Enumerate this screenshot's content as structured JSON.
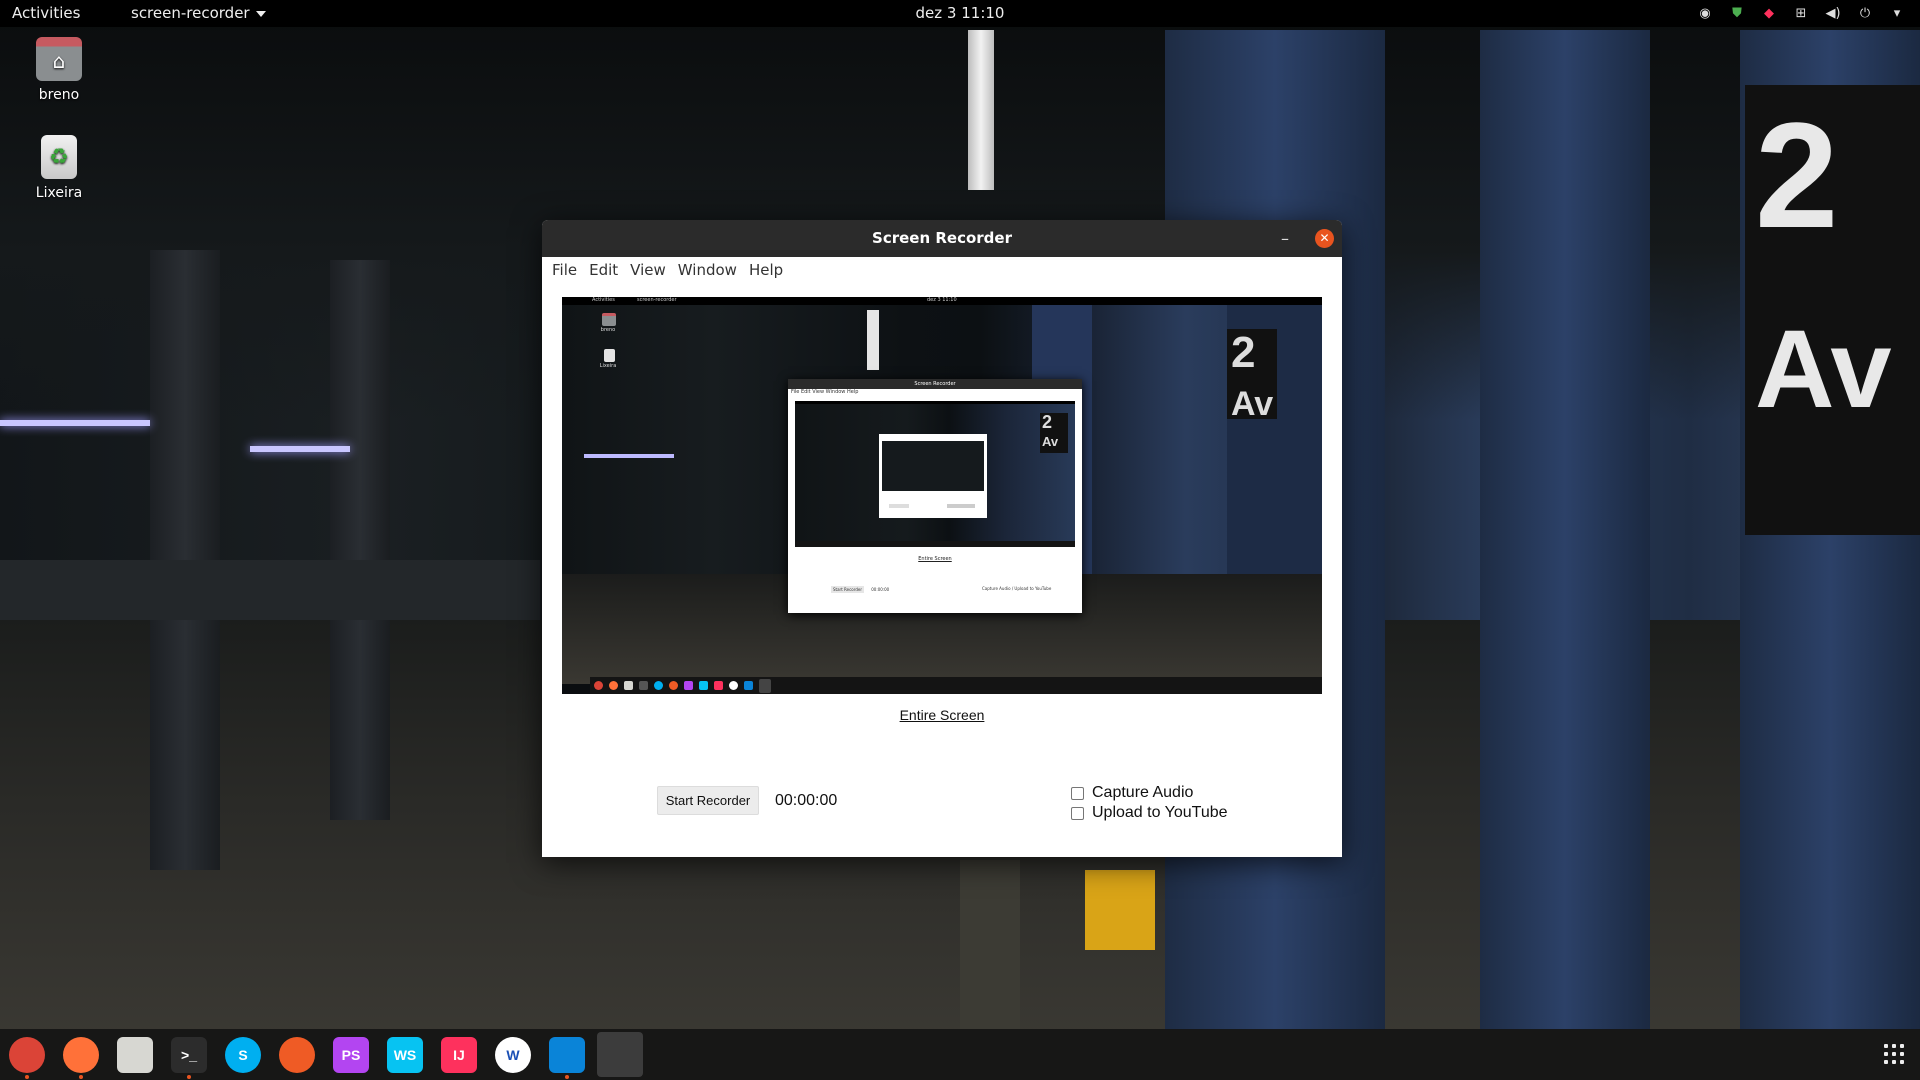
{
  "topbar": {
    "activities": "Activities",
    "app_menu": "screen-recorder",
    "clock": "dez 3  11:10",
    "tray_icons": [
      "discord-icon",
      "shield-icon",
      "jetbrains-toolbox-icon",
      "network-icon",
      "volume-icon",
      "power-icon",
      "chevron-down-icon"
    ]
  },
  "desktop": {
    "icons": [
      {
        "label": "breno",
        "icon": "home-folder-icon"
      },
      {
        "label": "Lixeira",
        "icon": "trash-icon"
      }
    ]
  },
  "window": {
    "title": "Screen Recorder",
    "menu": [
      "File",
      "Edit",
      "View",
      "Window",
      "Help"
    ],
    "preview_caption": "Entire Screen",
    "start_button": "Start Recorder",
    "timer": "00:00:00",
    "options": [
      {
        "label": "Capture Audio",
        "checked": false
      },
      {
        "label": "Upload to YouTube",
        "checked": false
      }
    ]
  },
  "preview": {
    "activities": "Activities",
    "app_menu": "screen-recorder",
    "clock": "dez 3  11:10",
    "desk_labels": [
      "breno",
      "Lixeira"
    ],
    "window_title": "Screen Recorder",
    "menu": "File  Edit  View  Window  Help",
    "caption": "Entire Screen",
    "start": "Start Recorder",
    "timer": "00:00:00",
    "options": "Capture Audio / Upload to YouTube"
  },
  "dock": {
    "apps": [
      {
        "name": "chrome-icon",
        "label": "",
        "color": "#db4437",
        "running": true
      },
      {
        "name": "firefox-icon",
        "label": "",
        "color": "#ff7139",
        "running": true
      },
      {
        "name": "files-icon",
        "label": "",
        "color": "#d7d7d2",
        "running": false
      },
      {
        "name": "terminal-icon",
        "label": ">_",
        "color": "#2c2c2c",
        "running": true
      },
      {
        "name": "skype-icon",
        "label": "S",
        "color": "#00aff0",
        "running": false
      },
      {
        "name": "postman-icon",
        "label": "",
        "color": "#ef5b25",
        "running": false
      },
      {
        "name": "phpstorm-icon",
        "label": "PS",
        "color": "#b345f1",
        "running": false
      },
      {
        "name": "webstorm-icon",
        "label": "WS",
        "color": "#07c3f2",
        "running": false
      },
      {
        "name": "intellij-icon",
        "label": "IJ",
        "color": "#fe315d",
        "running": false
      },
      {
        "name": "wps-icon",
        "label": "W",
        "color": "#ffffff",
        "running": false
      },
      {
        "name": "vscode-icon",
        "label": "",
        "color": "#0a84d8",
        "running": true
      }
    ],
    "show_apps": "show-applications-icon"
  }
}
